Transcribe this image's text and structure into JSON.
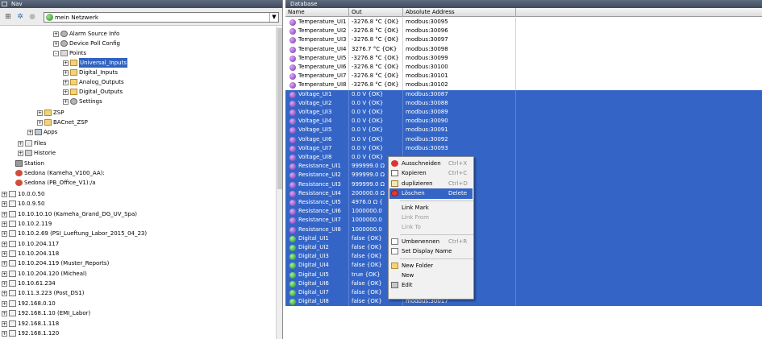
{
  "nav": {
    "title": "Nav",
    "combo_value": "mein Netzwerk",
    "tree": [
      {
        "label": "Alarm Source Info",
        "icon": "gear-icon",
        "expander": "+"
      },
      {
        "label": "Device Poll Config",
        "icon": "gear-icon",
        "expander": "+"
      },
      {
        "label": "Points",
        "icon": "points-icon",
        "expander": "-"
      },
      {
        "label": "Universal_Inputs",
        "icon": "folder-icon",
        "expander": "+",
        "selected": true
      },
      {
        "label": "Digital_Inputs",
        "icon": "folder-icon",
        "expander": "+"
      },
      {
        "label": "Analog_Outputs",
        "icon": "folder-icon",
        "expander": "+"
      },
      {
        "label": "Digital_Outputs",
        "icon": "folder-icon",
        "expander": "+"
      },
      {
        "label": "Settings",
        "icon": "gear-icon",
        "expander": "+"
      },
      {
        "label": "ZSP",
        "icon": "folder-icon",
        "expander": "+"
      },
      {
        "label": "BACnet_ZSP",
        "icon": "folder-icon",
        "expander": "+"
      },
      {
        "label": "Apps",
        "icon": "apps-icon",
        "expander": "+"
      },
      {
        "label": "Files",
        "icon": "files-icon",
        "expander": "+"
      },
      {
        "label": "Historie",
        "icon": "history-icon",
        "expander": "+"
      },
      {
        "label": "Station",
        "icon": "station-icon",
        "expander": ""
      },
      {
        "label": "Sedona (Kameha_V100_AA):",
        "icon": "sedona-icon",
        "expander": ""
      },
      {
        "label": "Sedona (PB_Office_V1):/a",
        "icon": "sedona-icon",
        "expander": ""
      },
      {
        "label": "10.0.0.50",
        "icon": "host-icon",
        "expander": "+"
      },
      {
        "label": "10.0.9.50",
        "icon": "host-icon",
        "expander": "+"
      },
      {
        "label": "10.10.10.10 (Kameha_Grand_DG_UV_Spa)",
        "icon": "host-icon",
        "expander": "+"
      },
      {
        "label": "10.10.2.119",
        "icon": "host-icon",
        "expander": "+"
      },
      {
        "label": "10.10.2.69 (PSI_Lueftung_Labor_2015_04_23)",
        "icon": "host-icon",
        "expander": "+"
      },
      {
        "label": "10.10.204.117",
        "icon": "host-icon",
        "expander": "+"
      },
      {
        "label": "10.10.204.118",
        "icon": "host-icon",
        "expander": "+"
      },
      {
        "label": "10.10.204.119 (Muster_Reports)",
        "icon": "host-icon",
        "expander": "+"
      },
      {
        "label": "10.10.204.120 (Micheal)",
        "icon": "host-icon",
        "expander": "+"
      },
      {
        "label": "10.10.61.234",
        "icon": "host-icon",
        "expander": "+"
      },
      {
        "label": "10.11.3.223 (Post_DS1)",
        "icon": "host-icon",
        "expander": "+"
      },
      {
        "label": "192.168.0.10",
        "icon": "host-icon",
        "expander": "+"
      },
      {
        "label": "192.168.1.10 (EMI_Labor)",
        "icon": "host-icon",
        "expander": "+"
      },
      {
        "label": "192.168.1.118",
        "icon": "host-icon",
        "expander": "+"
      },
      {
        "label": "192.168.1.120",
        "icon": "host-icon",
        "expander": "+"
      }
    ]
  },
  "database": {
    "title": "Database",
    "columns": [
      "Name",
      "Out",
      "Absolute Address"
    ],
    "rows": [
      {
        "name": "Temperature_UI1",
        "out": "-3276.8 °C {OK}",
        "addr": "modbus:30095",
        "icon": "purple",
        "selected": false
      },
      {
        "name": "Temperature_UI2",
        "out": "-3276.8 °C {OK}",
        "addr": "modbus:30096",
        "icon": "purple",
        "selected": false
      },
      {
        "name": "Temperature_UI3",
        "out": "-3276.8 °C {OK}",
        "addr": "modbus:30097",
        "icon": "purple",
        "selected": false
      },
      {
        "name": "Temperature_UI4",
        "out": "3276.7 °C {OK}",
        "addr": "modbus:30098",
        "icon": "purple",
        "selected": false
      },
      {
        "name": "Temperature_UI5",
        "out": "-3276.8 °C {OK}",
        "addr": "modbus:30099",
        "icon": "purple",
        "selected": false
      },
      {
        "name": "Temperature_UI6",
        "out": "-3276.8 °C {OK}",
        "addr": "modbus:30100",
        "icon": "purple",
        "selected": false
      },
      {
        "name": "Temperature_UI7",
        "out": "-3276.8 °C {OK}",
        "addr": "modbus:30101",
        "icon": "purple",
        "selected": false
      },
      {
        "name": "Temperature_UI8",
        "out": "-3276.8 °C {OK}",
        "addr": "modbus:30102",
        "icon": "purple",
        "selected": false
      },
      {
        "name": "Voltage_UI1",
        "out": "0.0 V {OK}",
        "addr": "modbus:30087",
        "icon": "purple",
        "selected": true
      },
      {
        "name": "Voltage_UI2",
        "out": "0.0 V {OK}",
        "addr": "modbus:30088",
        "icon": "purple",
        "selected": true
      },
      {
        "name": "Voltage_UI3",
        "out": "0.0 V {OK}",
        "addr": "modbus:30089",
        "icon": "purple",
        "selected": true
      },
      {
        "name": "Voltage_UI4",
        "out": "0.0 V {OK}",
        "addr": "modbus:30090",
        "icon": "purple",
        "selected": true
      },
      {
        "name": "Voltage_UI5",
        "out": "0.0 V {OK}",
        "addr": "modbus:30091",
        "icon": "purple",
        "selected": true
      },
      {
        "name": "Voltage_UI6",
        "out": "0.0 V {OK}",
        "addr": "modbus:30092",
        "icon": "purple",
        "selected": true
      },
      {
        "name": "Voltage_UI7",
        "out": "0.0 V {OK}",
        "addr": "modbus:30093",
        "icon": "purple",
        "selected": true
      },
      {
        "name": "Voltage_UI8",
        "out": "0.0 V {OK}",
        "addr": "",
        "icon": "purple",
        "selected": true
      },
      {
        "name": "Resistance_UI1",
        "out": "999999.0 Ω",
        "addr": "",
        "icon": "purple",
        "selected": true
      },
      {
        "name": "Resistance_UI2",
        "out": "999999.0 Ω",
        "addr": "",
        "icon": "purple",
        "selected": true
      },
      {
        "name": "Resistance_UI3",
        "out": "999999.0 Ω",
        "addr": "",
        "icon": "purple",
        "selected": true
      },
      {
        "name": "Resistance_UI4",
        "out": "200000.0 Ω",
        "addr": "",
        "icon": "purple",
        "selected": true
      },
      {
        "name": "Resistance_UI5",
        "out": "4976.0 Ω {",
        "addr": "",
        "icon": "purple",
        "selected": true
      },
      {
        "name": "Resistance_UI6",
        "out": "1000000.0",
        "addr": "",
        "icon": "purple",
        "selected": true
      },
      {
        "name": "Resistance_UI7",
        "out": "1000000.0",
        "addr": "",
        "icon": "purple",
        "selected": true
      },
      {
        "name": "Resistance_UI8",
        "out": "1000000.0",
        "addr": "",
        "icon": "purple",
        "selected": true
      },
      {
        "name": "Digital_UI1",
        "out": "false {OK}",
        "addr": "",
        "icon": "green",
        "selected": true
      },
      {
        "name": "Digital_UI2",
        "out": "false {OK}",
        "addr": "",
        "icon": "green",
        "selected": true
      },
      {
        "name": "Digital_UI3",
        "out": "false {OK}",
        "addr": "",
        "icon": "green",
        "selected": true
      },
      {
        "name": "Digital_UI4",
        "out": "false {OK}",
        "addr": "",
        "icon": "green",
        "selected": true
      },
      {
        "name": "Digital_UI5",
        "out": "true {OK}",
        "addr": "",
        "icon": "green",
        "selected": true
      },
      {
        "name": "Digital_UI6",
        "out": "false {OK}",
        "addr": "",
        "icon": "green",
        "selected": true
      },
      {
        "name": "Digital_UI7",
        "out": "false {OK}",
        "addr": "",
        "icon": "green",
        "selected": true
      },
      {
        "name": "Digital_UI8",
        "out": "false {OK}",
        "addr": "modbus:30017",
        "icon": "green",
        "selected": true
      }
    ]
  },
  "context_menu": {
    "items": [
      {
        "label": "Ausschneiden",
        "shortcut": "Ctrl+X",
        "icon": "cut-icon",
        "state": "normal"
      },
      {
        "label": "Kopieren",
        "shortcut": "Ctrl+C",
        "icon": "copy-icon",
        "state": "normal"
      },
      {
        "label": "duplizieren",
        "shortcut": "Ctrl+D",
        "icon": "duplicate-icon",
        "state": "normal"
      },
      {
        "label": "Löschen",
        "shortcut": "Delete",
        "icon": "delete-icon",
        "state": "highlighted"
      },
      {
        "separator": true
      },
      {
        "label": "Link Mark",
        "shortcut": "",
        "icon": "",
        "state": "normal"
      },
      {
        "label": "Link From",
        "shortcut": "",
        "icon": "",
        "state": "disabled"
      },
      {
        "label": "Link To",
        "shortcut": "",
        "icon": "",
        "state": "disabled"
      },
      {
        "separator": true
      },
      {
        "label": "Umbenennen",
        "shortcut": "Ctrl+R",
        "icon": "rename-icon",
        "state": "normal"
      },
      {
        "label": "Set Display Name",
        "shortcut": "",
        "icon": "display-name-icon",
        "state": "normal"
      },
      {
        "separator": true
      },
      {
        "label": "New Folder",
        "shortcut": "",
        "icon": "folder-icon",
        "state": "normal"
      },
      {
        "label": "New",
        "shortcut": "",
        "icon": "",
        "state": "normal"
      },
      {
        "label": "Edit",
        "shortcut": "",
        "icon": "edit-icon",
        "state": "normal"
      }
    ]
  },
  "colors": {
    "selection": "#3465c6",
    "title_bar": "#4a5668",
    "menu_bg": "#f1f1f1"
  }
}
